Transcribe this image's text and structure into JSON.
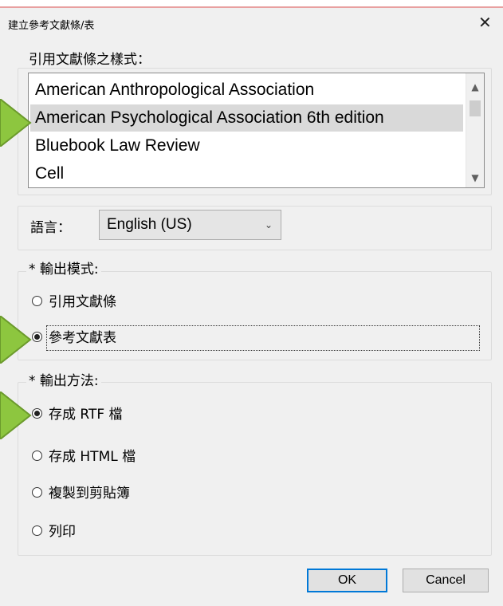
{
  "dialog": {
    "title": "建立參考文獻條/表",
    "close_glyph": "✕"
  },
  "style_group": {
    "legend": "引用文獻條之樣式：",
    "items": [
      "American Anthropological Association",
      "American Psychological Association 6th edition",
      "Bluebook Law Review",
      "Cell"
    ],
    "selected_index": 1
  },
  "language": {
    "label": "語言：",
    "value": "English (US)"
  },
  "output_mode": {
    "legend": "* 輸出模式:",
    "options": [
      "引用文獻條",
      "參考文獻表"
    ],
    "selected_index": 1
  },
  "output_method": {
    "legend": "* 輸出方法:",
    "options": [
      "存成 RTF 檔",
      "存成 HTML 檔",
      "複製到剪貼簿",
      "列印"
    ],
    "selected_index": 0
  },
  "buttons": {
    "ok": "OK",
    "cancel": "Cancel"
  },
  "colors": {
    "pointer_arrow_fill": "#8dc63f",
    "pointer_arrow_stroke": "#6b9a2c",
    "default_button_border": "#0078d7"
  }
}
